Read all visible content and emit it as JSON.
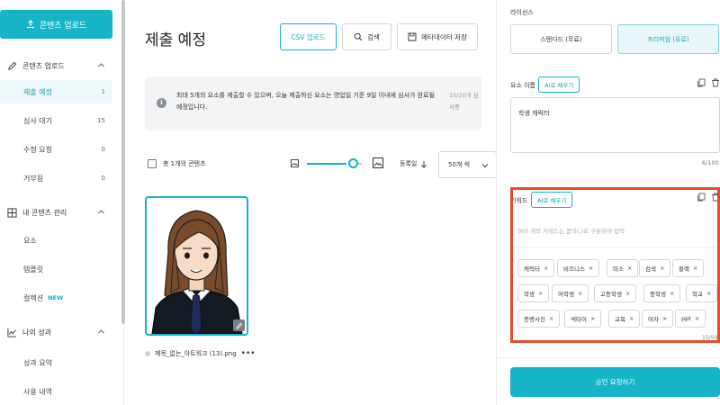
{
  "sidebar": {
    "upload_button": "콘텐츠 업로드",
    "groups": [
      {
        "label": "콘텐츠 업로드"
      },
      {
        "label": "내 콘텐츠 관리"
      },
      {
        "label": "나의 성과"
      }
    ],
    "items": [
      {
        "label": "제출 예정",
        "count": "1"
      },
      {
        "label": "심사 대기",
        "count": "15"
      },
      {
        "label": "수정 요청",
        "count": "0"
      },
      {
        "label": "거부됨",
        "count": "0"
      },
      {
        "label": "요소"
      },
      {
        "label": "템플릿"
      },
      {
        "label": "컬렉션",
        "badge": "NEW"
      },
      {
        "label": "성과 요약"
      },
      {
        "label": "사용 내역"
      }
    ]
  },
  "main": {
    "title": "제출 예정",
    "toolbar": {
      "csv_upload": "CSV 업로드",
      "search": "검색",
      "save_metadata": "메타데이터 저장"
    },
    "notice": {
      "text": "최대 5개의 요소를 제출할 수 있으며, 오늘 제출하신 요소는 영업일 기준 9일 이내에 심사가 완료될 예정입니다.",
      "side": "15/20개 심사중"
    },
    "filter": {
      "total": "총 1개의 콘텐츠",
      "sort": "등록일",
      "per_page": "50개 씩"
    },
    "card": {
      "filename": "제목_없는_아트워크 (13).png",
      "more": "•••"
    }
  },
  "right": {
    "license_label": "라이선스",
    "license_standard": "스탠다드 (무료)",
    "license_premium": "프리미엄 (유료)",
    "element_name_label": "요소 이름",
    "ai_fill": "AI로 채우기",
    "element_name_value": "학생 캐릭터",
    "char_count": "6/100",
    "keyword_label": "키워드",
    "keyword_placeholder": "여러 개의 키워드는 콤마(,)로 구분하여 입력",
    "keywords": [
      "캐릭터",
      "비즈니스",
      "미소",
      "검색",
      "블랙",
      "학생",
      "여학생",
      "고등학생",
      "중학생",
      "학교",
      "증명사진",
      "넥타이",
      "교복",
      "여자",
      "ppt"
    ],
    "keyword_count": "15/50",
    "approve_button": "승인 요청하기"
  },
  "colors": {
    "accent": "#17b3c6",
    "highlight": "#ea4a2b"
  }
}
